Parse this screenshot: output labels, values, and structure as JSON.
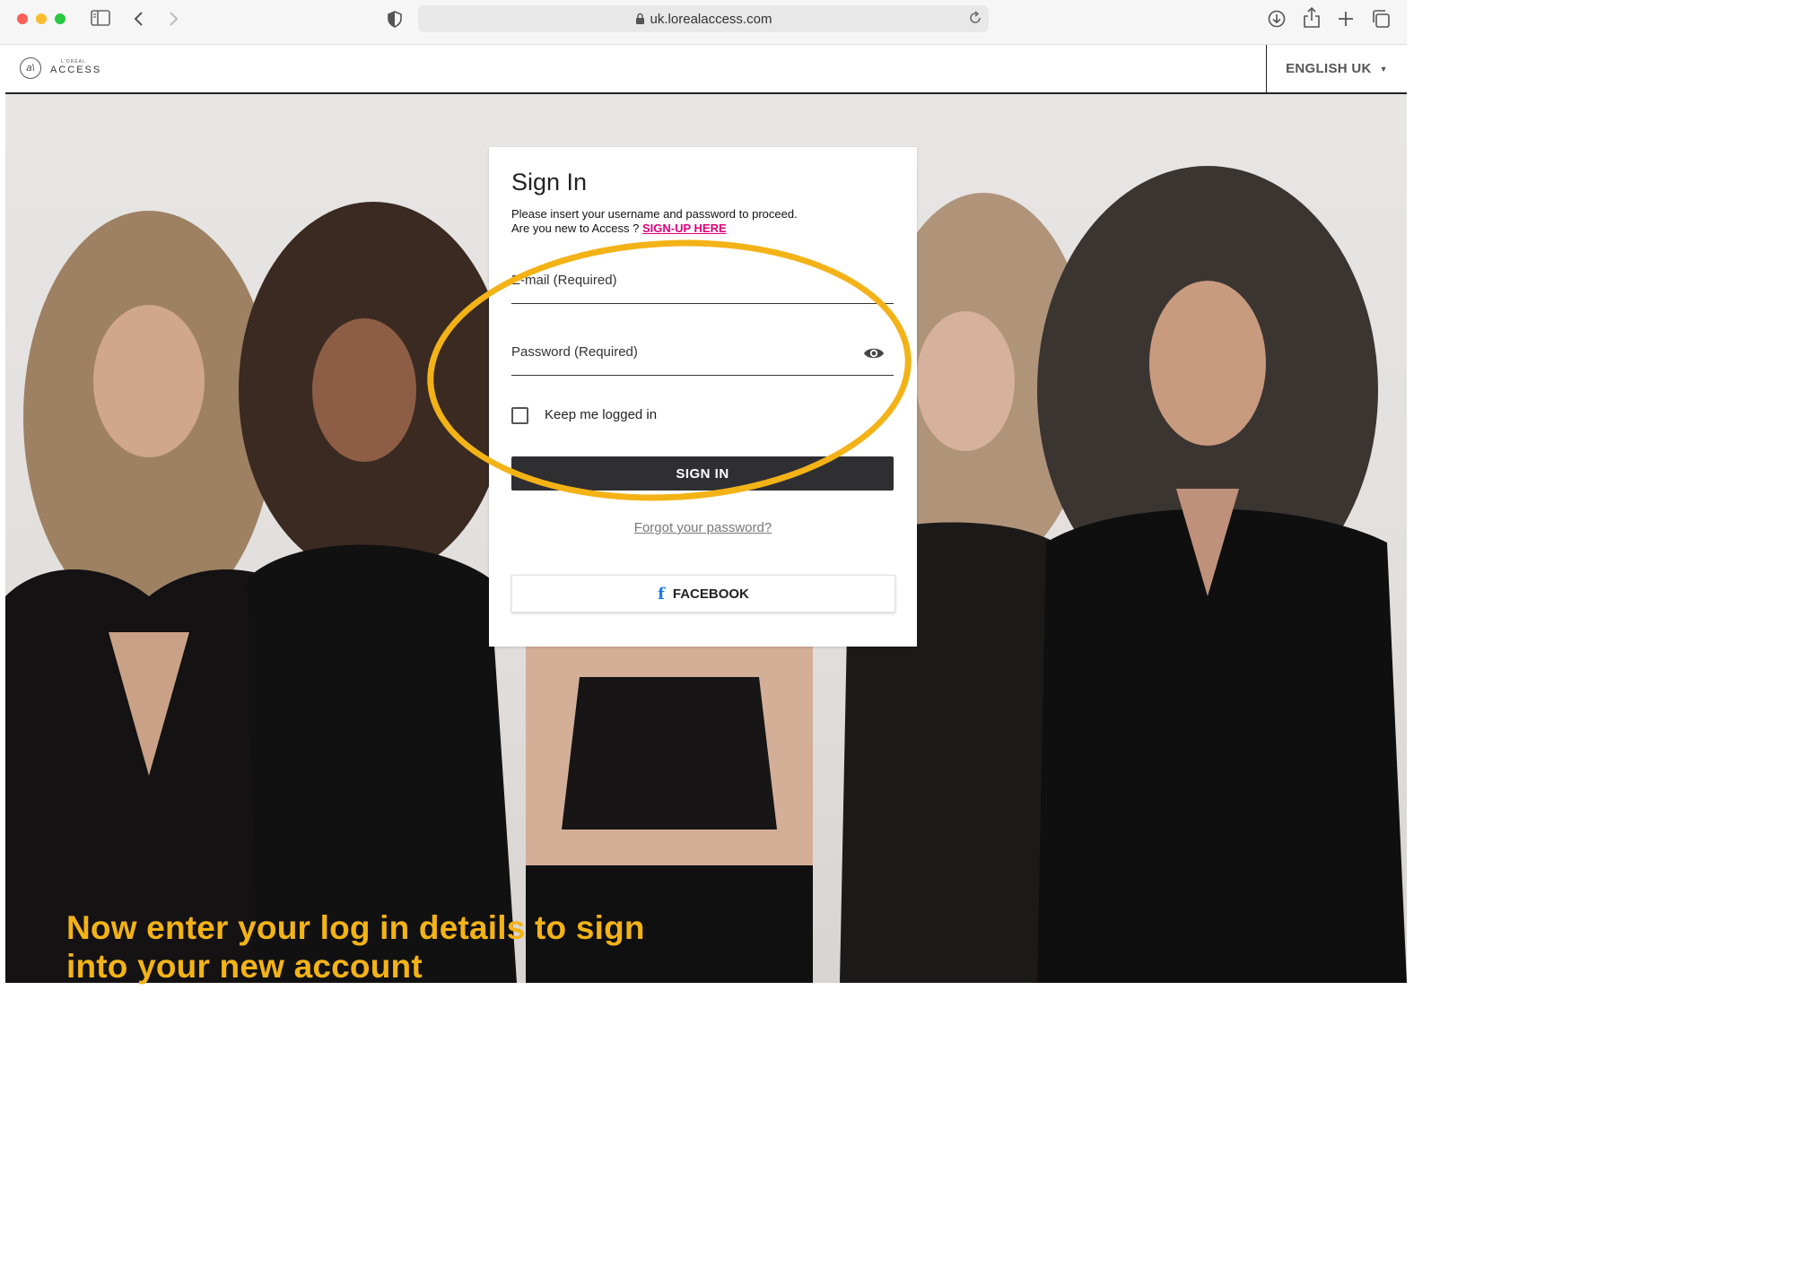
{
  "browser": {
    "url": "uk.lorealaccess.com"
  },
  "site": {
    "logo_small": "L'ORÉAL",
    "logo_text": "ACCESS",
    "language": "ENGLISH UK"
  },
  "signin": {
    "title": "Sign In",
    "subtitle_line1": "Please insert your username and password to proceed.",
    "subtitle_line2": "Are you new to Access ?",
    "signup_link": "SIGN-UP HERE",
    "email_placeholder": "E-mail (Required)",
    "password_placeholder": "Password (Required)",
    "keep_logged_in": "Keep me logged in",
    "signin_button": "SIGN IN",
    "forgot_password": "Forgot your password?",
    "facebook_button": "FACEBOOK"
  },
  "annotation": {
    "caption_line1": "Now enter your log in details to sign",
    "caption_line2": "into your new account",
    "highlight_color": "#f3b317"
  },
  "colors": {
    "signup_link": "#e0007a",
    "button_dark": "#2f2f32",
    "facebook_blue": "#1877f2"
  }
}
